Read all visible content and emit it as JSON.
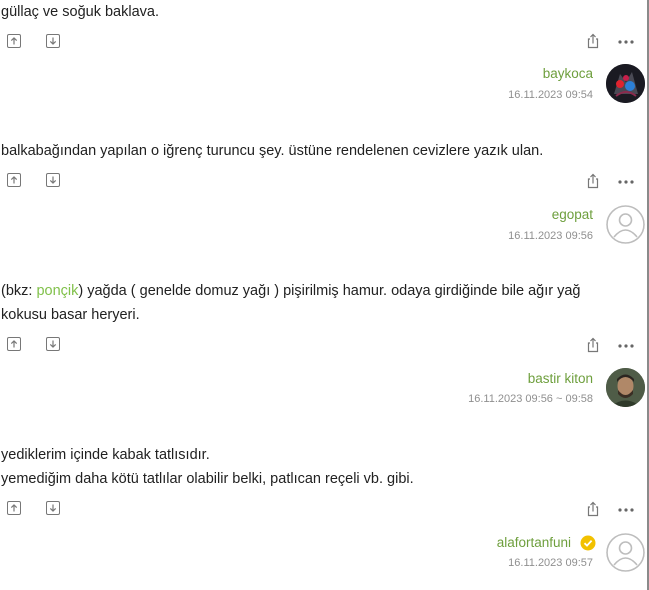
{
  "entries": [
    {
      "lines": [
        "güllaç ve soğuk baklava."
      ],
      "author": "baykoca",
      "date": "16.11.2023 09:54",
      "avatar": "avatar-image",
      "verified": false
    },
    {
      "lines": [
        "balkabağından yapılan o iğrenç turuncu şey. üstüne rendelenen cevizlere yazık ulan."
      ],
      "author": "egopat",
      "date": "16.11.2023 09:56",
      "avatar": "default-user-icon",
      "verified": false
    },
    {
      "bkz_prefix": "(bkz: ",
      "bkz_link": "ponçik",
      "bkz_suffix": ") yağda ( genelde domuz yağı ) pişirilmiş hamur. odaya girdiğinde bile ağır yağ",
      "line2": "kokusu basar heryeri.",
      "author": "bastir kiton",
      "date": "16.11.2023 09:56 ~ 09:58",
      "avatar": "avatar-image",
      "verified": false
    },
    {
      "lines": [
        "yediklerim içinde kabak tatlısıdır.",
        "yemediğim daha kötü tatlılar olabilir belki, patlıcan reçeli vb. gibi."
      ],
      "author": "alafortanfuni",
      "date": "16.11.2023 09:57",
      "avatar": "default-user-icon",
      "verified": true
    }
  ],
  "colors": {
    "link": "#81c14b",
    "author": "#6e9f3d",
    "date": "#8f8f8f",
    "verified": "#f2c100"
  }
}
